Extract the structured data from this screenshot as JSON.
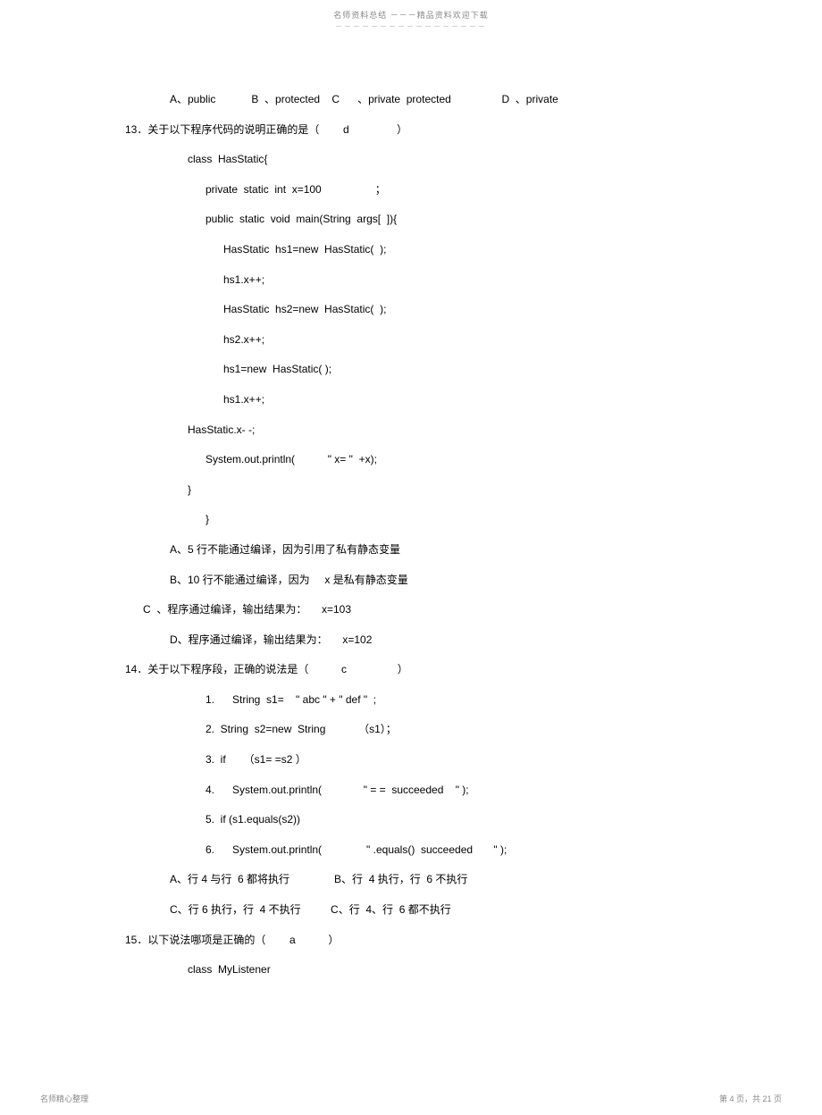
{
  "header": {
    "text": "名师资料总结  －－－精品资料欢迎下载",
    "dash": "－－－－－－－－－－－－－－－－－"
  },
  "q12_options": "A、public            B  、protected    C      、private  protected                 D  、private",
  "q13": {
    "stem": "13．关于以下程序代码的说明正确的是（        d                ）",
    "code": {
      "l1": "class  HasStatic{",
      "l2": "private  static  int  x=100                  ；",
      "l3": "public  static  void  main(String  args[  ]){",
      "l4": "HasStatic  hs1=new  HasStatic(  );",
      "l5": "hs1.x++;",
      "l6": "HasStatic  hs2=new  HasStatic(  );",
      "l7": "hs2.x++;",
      "l8": "hs1=new  HasStatic( );",
      "l9": "hs1.x++;",
      "l10": "HasStatic.x- -;",
      "l11": "System.out.println(           \" x= \"  +x);",
      "l12": "}",
      "l13": "}"
    },
    "optA": "A、5 行不能通过编译，因为引用了私有静态变量",
    "optB": "B、10 行不能通过编译，因为     x 是私有静态变量",
    "optC": "C  、程序通过编译，输出结果为：     x=103",
    "optD": "D、程序通过编译，输出结果为：     x=102"
  },
  "q14": {
    "stem": "14．关于以下程序段，正确的说法是（           c                 ）",
    "code": {
      "l1": "1.      String  s1=    \" abc \" + \" def \"  ;",
      "l2": "2.  String  s2=new  String           （s1）；",
      "l3": "3.  if      （s1= =s2 ）",
      "l4": "4.      System.out.println(              \" = =  succeeded    \" );",
      "l5": "5.  if (s1.equals(s2))",
      "l6": "6.      System.out.println(               \" .equals()  succeeded       \" );"
    },
    "optAB": "A、行 4 与行  6 都将执行               B、行  4 执行，行  6 不执行",
    "optCD": "C、行 6 执行，行  4 不执行          C、行  4、行  6 都不执行"
  },
  "q15": {
    "stem": "15．以下说法哪项是正确的（        a           ）",
    "code": {
      "l1": "class  MyListener"
    }
  },
  "footer": {
    "left": "名师精心整理",
    "right": "第 4 页，共 21 页"
  }
}
